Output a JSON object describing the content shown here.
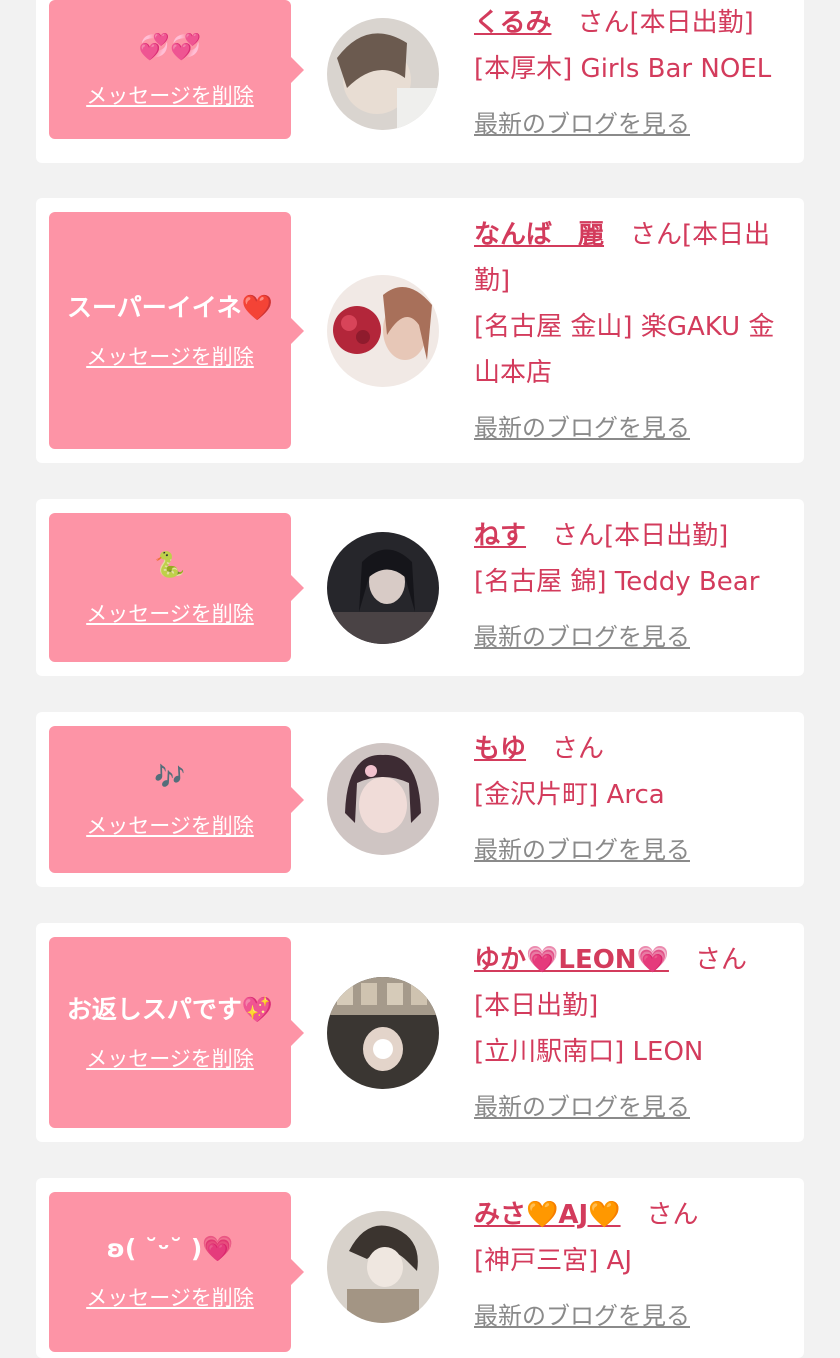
{
  "cards": [
    {
      "message": "💞💞",
      "delete_label": "メッセージを削除",
      "name": "くるみ",
      "suffix": "さん",
      "status": "[本日出勤]",
      "shop": "[本厚木] Girls Bar NOEL",
      "blog_label": "最新のブログを見る",
      "avatar_color": "#c8c0bc"
    },
    {
      "message": "スーパーイイネ❤️",
      "delete_label": "メッセージを削除",
      "name": "なんば　麗",
      "suffix": "さん",
      "status": "[本日出勤]",
      "shop": "[名古屋 金山] 楽GAKU 金山本店",
      "blog_label": "最新のブログを見る",
      "avatar_color": "#8a3a3a"
    },
    {
      "message": "🐍",
      "delete_label": "メッセージを削除",
      "name": "ねす",
      "suffix": "さん",
      "status": "[本日出勤]",
      "shop": "[名古屋 錦] Teddy Bear",
      "blog_label": "最新のブログを見る",
      "avatar_color": "#2a2a30"
    },
    {
      "message": "🎶",
      "delete_label": "メッセージを削除",
      "name": "もゆ",
      "suffix": "さん",
      "status": "",
      "shop": "[金沢片町] Arca",
      "blog_label": "最新のブログを見る",
      "avatar_color": "#6a4a52"
    },
    {
      "message": "お返しスパです💖",
      "delete_label": "メッセージを削除",
      "name": "ゆか💗LEON💗",
      "suffix": "さん",
      "status": "[本日出勤]",
      "shop": "[立川駅南口] LEON",
      "blog_label": "最新のブログを見る",
      "avatar_color": "#3a3632"
    },
    {
      "message": "ʚ( ˘ᵕ˘ )💗",
      "delete_label": "メッセージを削除",
      "name": "みさ🧡AJ🧡",
      "suffix": "さん",
      "status": "[本日出勤]",
      "shop": "[神戸三宮] AJ",
      "blog_label": "最新のブログを見る",
      "avatar_color": "#bcb2a8"
    }
  ]
}
